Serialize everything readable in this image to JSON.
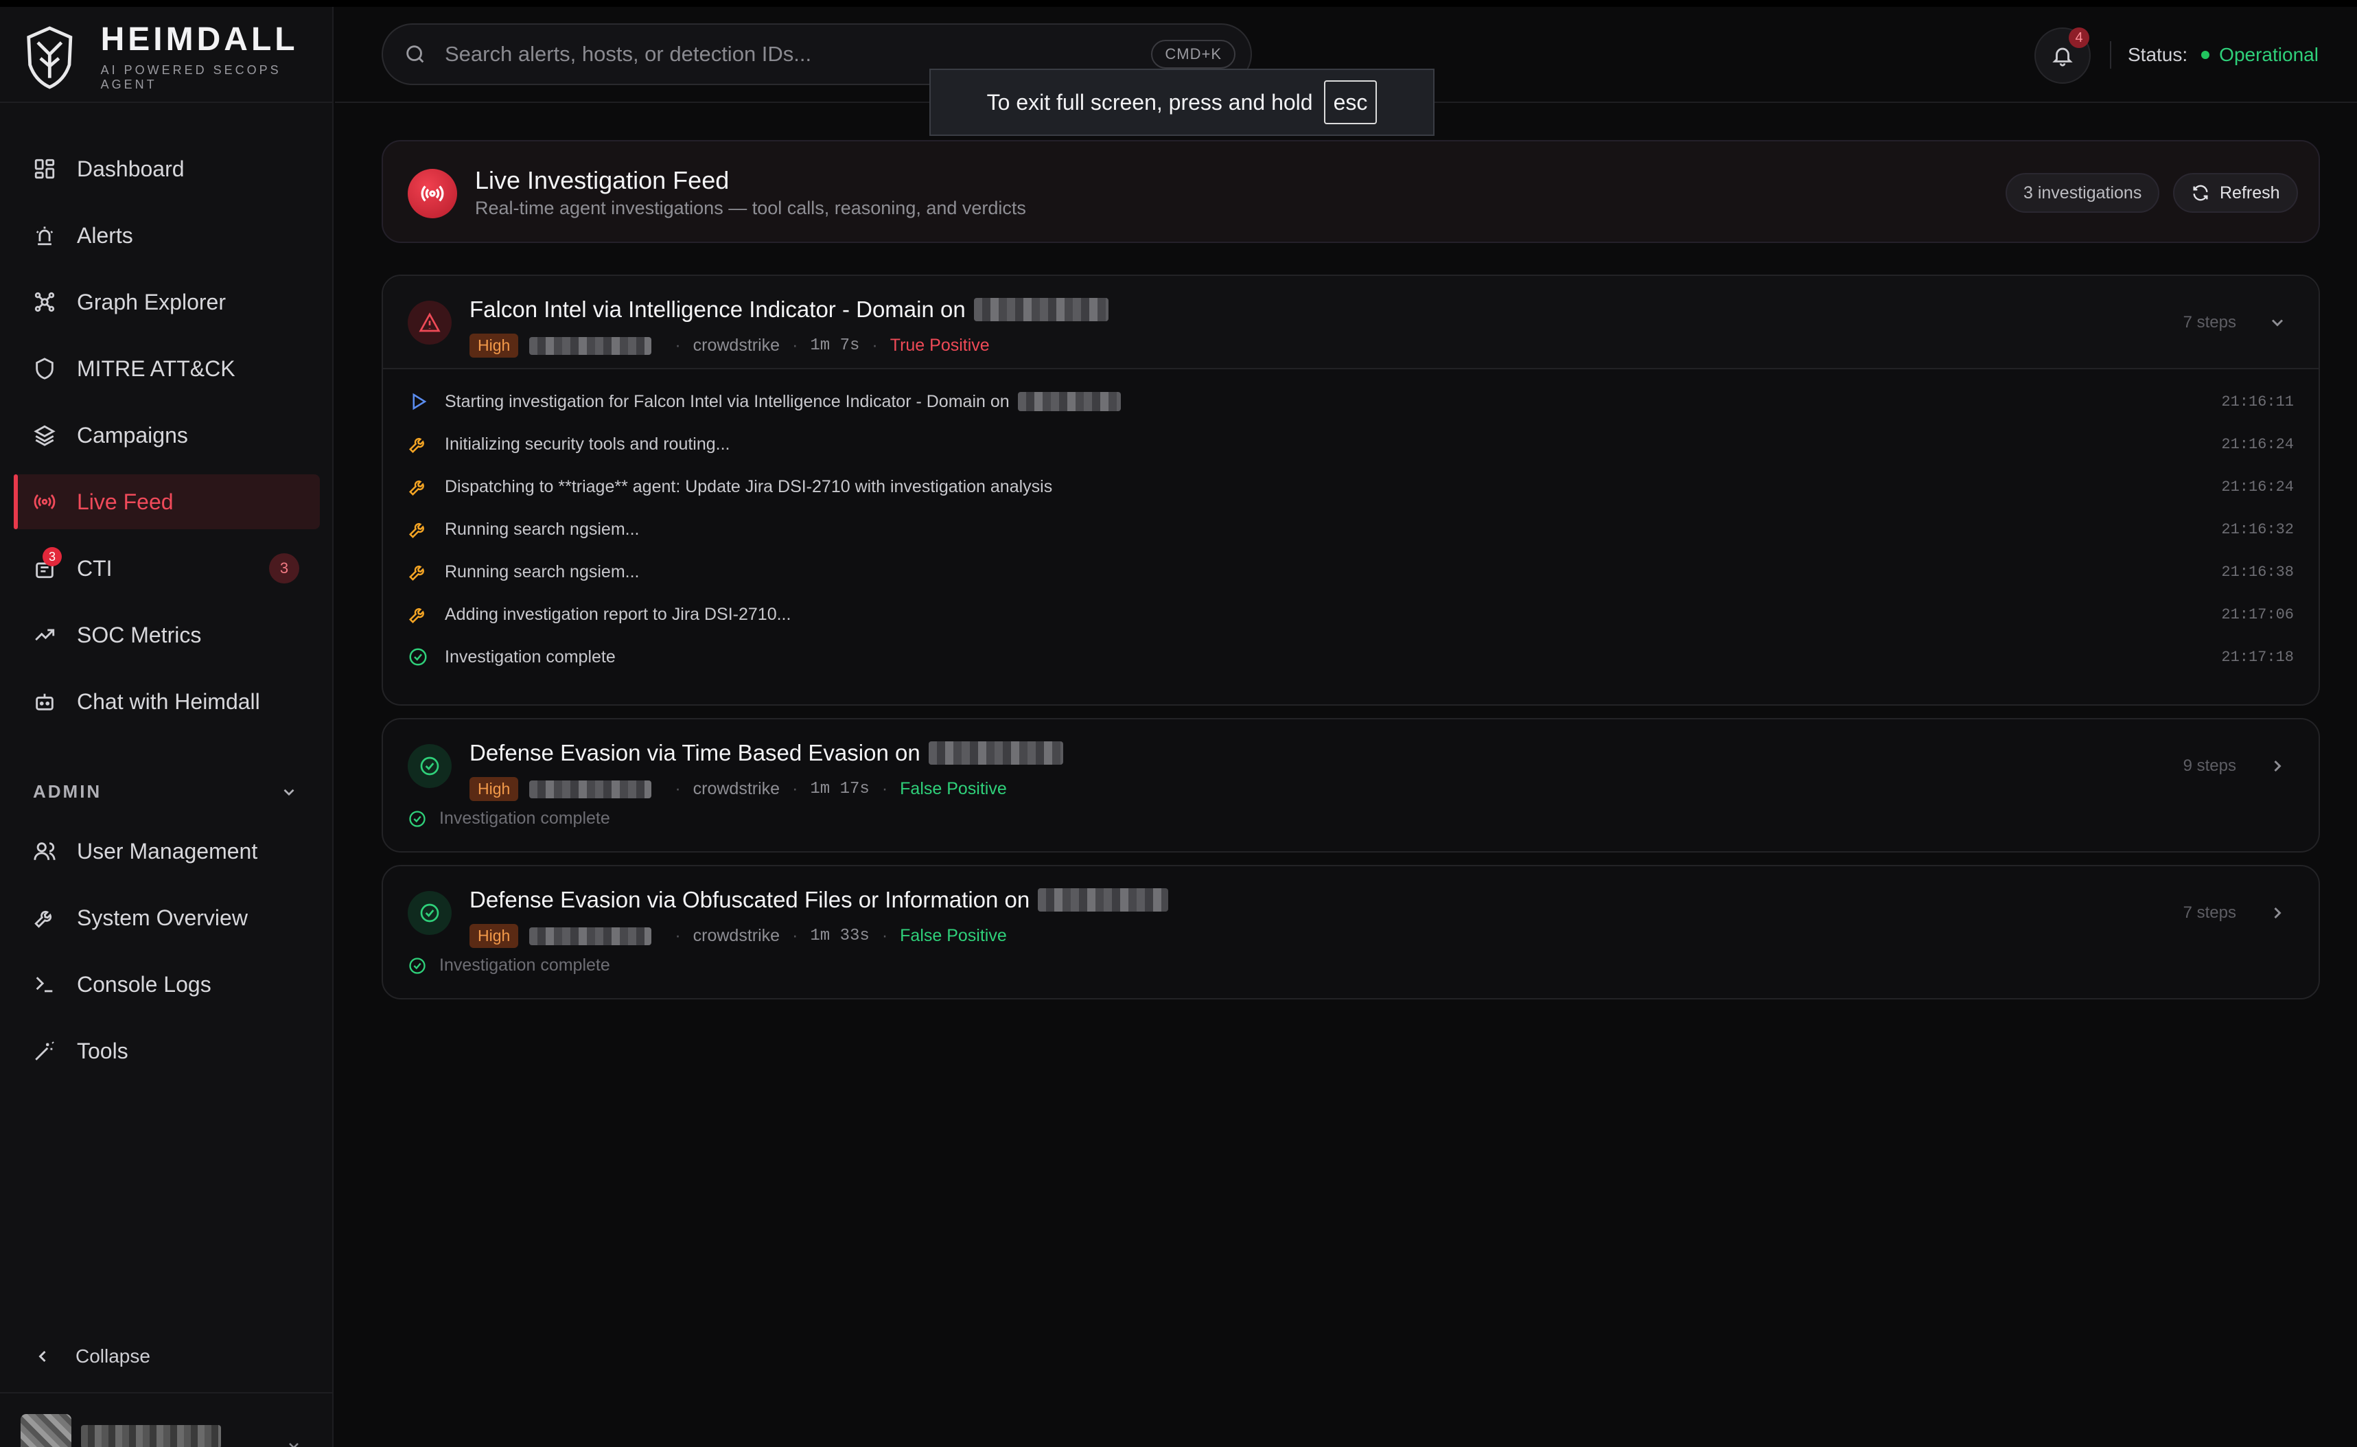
{
  "brand": {
    "name": "HEIMDALL",
    "subtitle": "AI POWERED SECOPS AGENT"
  },
  "nav": {
    "items": [
      {
        "label": "Dashboard",
        "icon": "dashboard-icon"
      },
      {
        "label": "Alerts",
        "icon": "alarm-icon"
      },
      {
        "label": "Graph Explorer",
        "icon": "graph-icon"
      },
      {
        "label": "MITRE ATT&CK",
        "icon": "shield-icon"
      },
      {
        "label": "Campaigns",
        "icon": "layers-icon"
      },
      {
        "label": "Live Feed",
        "icon": "broadcast-icon",
        "active": true
      },
      {
        "label": "CTI",
        "icon": "cti-icon",
        "badge": "3",
        "count": "3"
      },
      {
        "label": "SOC Metrics",
        "icon": "trending-icon"
      },
      {
        "label": "Chat with Heimdall",
        "icon": "bot-icon"
      }
    ],
    "admin_label": "ADMIN",
    "admin_items": [
      {
        "label": "User Management",
        "icon": "users-icon"
      },
      {
        "label": "System Overview",
        "icon": "wrench-icon"
      },
      {
        "label": "Console Logs",
        "icon": "terminal-icon"
      },
      {
        "label": "Tools",
        "icon": "wand-icon"
      }
    ],
    "collapse_label": "Collapse"
  },
  "topbar": {
    "search_placeholder": "Search alerts, hosts, or detection IDs...",
    "shortcut": "CMD+K",
    "notification_count": "4",
    "status_label": "Status:",
    "status_value": "Operational"
  },
  "toast": {
    "text": "To exit full screen, press and hold",
    "key": "esc"
  },
  "feed": {
    "title": "Live Investigation Feed",
    "subtitle": "Real-time agent investigations — tool calls, reasoning, and verdicts",
    "count_label": "3 investigations",
    "refresh_label": "Refresh"
  },
  "investigations": [
    {
      "title": "Falcon Intel via Intelligence Indicator - Domain on",
      "severity": "High",
      "source": "crowdstrike",
      "duration": "1m 7s",
      "verdict": "True Positive",
      "steps": "7 steps",
      "expanded": true,
      "events": [
        {
          "icon": "play-icon",
          "text": "Starting investigation for Falcon Intel via Intelligence Indicator - Domain on",
          "time": "21:16:11"
        },
        {
          "icon": "wrench-icon",
          "text": "Initializing security tools and routing...",
          "time": "21:16:24"
        },
        {
          "icon": "wrench-icon",
          "text": "Dispatching to **triage** agent: Update Jira DSI-2710 with investigation analysis",
          "time": "21:16:24"
        },
        {
          "icon": "wrench-icon",
          "text": "Running search ngsiem...",
          "time": "21:16:32"
        },
        {
          "icon": "wrench-icon",
          "text": "Running search ngsiem...",
          "time": "21:16:38"
        },
        {
          "icon": "wrench-icon",
          "text": "Adding investigation report to Jira DSI-2710...",
          "time": "21:17:06"
        },
        {
          "icon": "check-circle-icon",
          "text": "Investigation complete",
          "time": "21:17:18"
        }
      ]
    },
    {
      "title": "Defense Evasion via Time Based Evasion on",
      "severity": "High",
      "source": "crowdstrike",
      "duration": "1m 17s",
      "verdict": "False Positive",
      "steps": "9 steps",
      "footer": "Investigation complete"
    },
    {
      "title": "Defense Evasion via Obfuscated Files or Information on",
      "severity": "High",
      "source": "crowdstrike",
      "duration": "1m 33s",
      "verdict": "False Positive",
      "steps": "7 steps",
      "footer": "Investigation complete"
    }
  ],
  "colors": {
    "accent_red": "#e8394b",
    "high_badge": "#f39a4a",
    "true_positive": "#ef4a57",
    "false_positive": "#2fd07a",
    "operational": "#2fd07a"
  }
}
